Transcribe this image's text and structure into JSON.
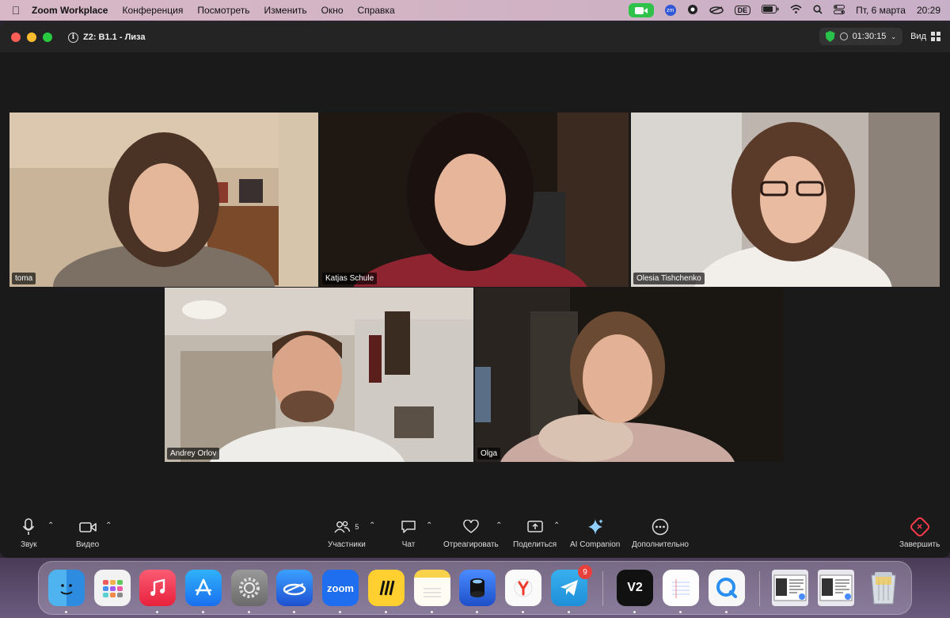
{
  "menubar": {
    "app_name": "Zoom Workplace",
    "menus": [
      "Конференция",
      "Посмотреть",
      "Изменить",
      "Окно",
      "Справка"
    ],
    "keyboard_layout": "DE",
    "zm_badge": "zm",
    "datetime_day": "Пт, 6 марта",
    "datetime_time": "20:29"
  },
  "window": {
    "meeting_title": "Z2: B1.1 - Лиза",
    "timer": "01:30:15",
    "view_label": "Вид"
  },
  "participants": [
    {
      "name": "toma",
      "active": false
    },
    {
      "name": "Katjas Schule",
      "active": true
    },
    {
      "name": "Olesia Tishchenko",
      "active": false
    },
    {
      "name": "Andrey Orlov",
      "active": false
    },
    {
      "name": "Olga",
      "active": false
    }
  ],
  "toolbar": {
    "audio_label": "Звук",
    "video_label": "Видео",
    "participants_label": "Участники",
    "participants_count": "5",
    "chat_label": "Чат",
    "react_label": "Отреагировать",
    "share_label": "Поделиться",
    "ai_label": "AI Companion",
    "more_label": "Дополнительно",
    "end_label": "Завершить"
  },
  "dock": {
    "zoom_label": "zoom",
    "telegram_badge": "9",
    "vpn_label": "V2"
  },
  "colors": {
    "active_speaker": "#3fc15c",
    "end_red": "#ff3b4a",
    "zoom_status_green": "#2ec24a"
  }
}
